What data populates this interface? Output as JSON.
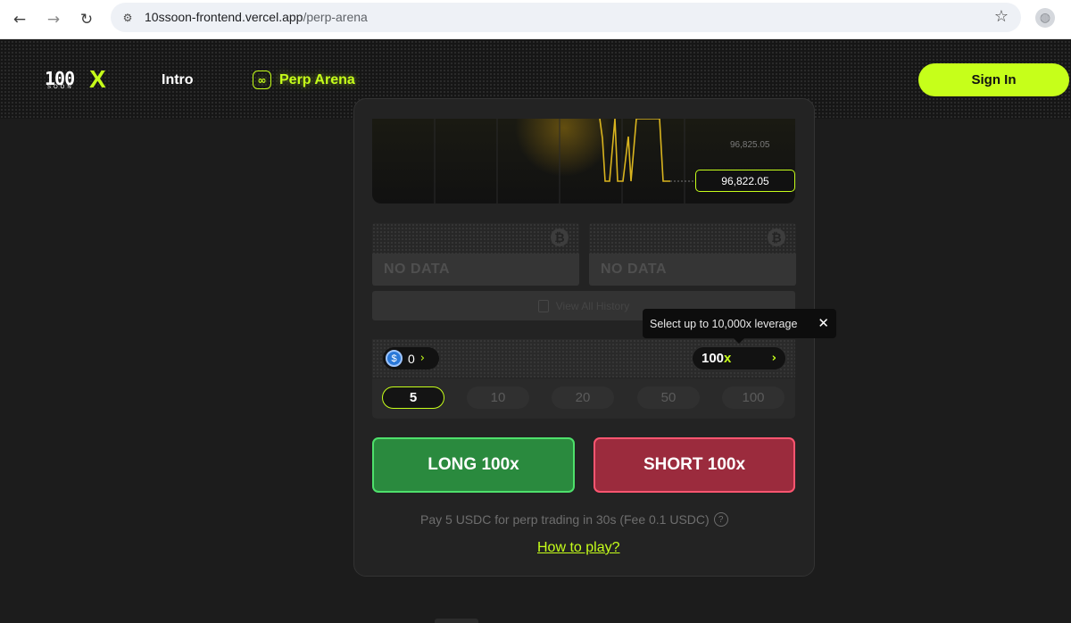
{
  "browser": {
    "url_domain": "10ssoon-frontend.vercel.app",
    "url_path": "/perp-arena",
    "back_icon": "back-arrow-icon",
    "forward_icon": "forward-arrow-icon",
    "reload_icon": "reload-icon"
  },
  "header": {
    "logo_num": "100",
    "logo_sub": "SOON",
    "logo_x": "X",
    "nav_intro": "Intro",
    "nav_perp": "Perp Arena",
    "signin_label": "Sign In",
    "accent_color": "#c6ff1a"
  },
  "chart": {
    "price_level": "96,825.05",
    "current_price": "96,822.05"
  },
  "history": {
    "cards": [
      {
        "label": "NO DATA"
      },
      {
        "label": "NO DATA"
      }
    ],
    "view_all": "View All History"
  },
  "tooltip": {
    "text": "Select up to 10,000x leverage"
  },
  "leverage": {
    "usdc_balance": "0",
    "leverage_num": "100",
    "leverage_x": "x",
    "amounts": [
      "5",
      "10",
      "20",
      "50",
      "100"
    ],
    "selected_amount": "5"
  },
  "actions": {
    "long_label": "LONG 100x",
    "short_label": "SHORT 100x",
    "long_color": "#2a8a3e",
    "short_color": "#9b2b3d",
    "pay_text": "Pay 5 USDC for perp trading in 30s (Fee 0.1 USDC)",
    "how_to": "How to play?"
  }
}
